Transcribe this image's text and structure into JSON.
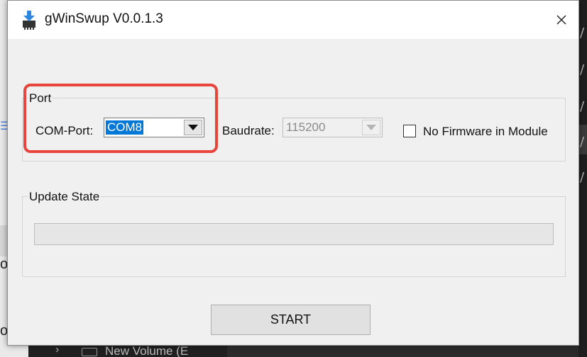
{
  "window": {
    "title": "gWinSwup V0.0.1.3",
    "close_symbol": "✕",
    "icon": "download-chip-icon"
  },
  "port_group": {
    "title": "Port",
    "com_port_label": "COM-Port:",
    "com_port_value": "COM8",
    "baudrate_label": "Baudrate:",
    "baudrate_value": "115200",
    "baudrate_enabled": false,
    "no_firmware_label": "No Firmware in Module",
    "no_firmware_checked": false
  },
  "update_group": {
    "title": "Update State",
    "progress": 0
  },
  "start_button": {
    "label": "START"
  },
  "background": {
    "bottom_item": "New Volume (E"
  },
  "colors": {
    "highlight": "#e8453c",
    "selection": "#0078d7",
    "window_bg": "#f0f0f0"
  }
}
